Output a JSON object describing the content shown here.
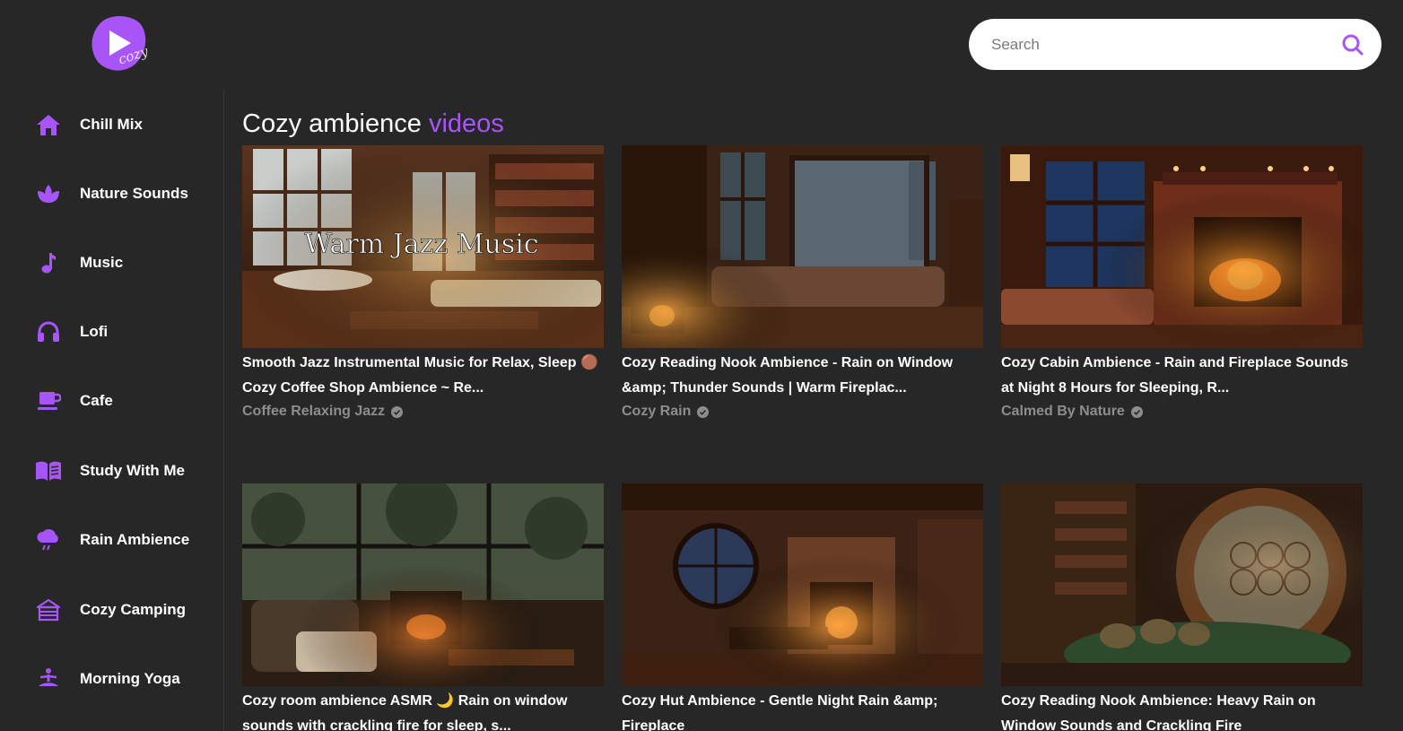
{
  "app": {
    "brand_color": "#a855f7",
    "logo_text": "cozy"
  },
  "search": {
    "placeholder": "Search",
    "value": ""
  },
  "sidebar": {
    "items": [
      {
        "label": "Chill Mix",
        "icon": "home-icon"
      },
      {
        "label": "Nature Sounds",
        "icon": "lotus-icon"
      },
      {
        "label": "Music",
        "icon": "music-note-icon"
      },
      {
        "label": "Lofi",
        "icon": "headphones-icon"
      },
      {
        "label": "Cafe",
        "icon": "coffee-cup-icon"
      },
      {
        "label": "Study With Me",
        "icon": "book-icon"
      },
      {
        "label": "Rain Ambience",
        "icon": "rain-cloud-icon"
      },
      {
        "label": "Cozy Camping",
        "icon": "campsite-icon"
      },
      {
        "label": "Morning Yoga",
        "icon": "yoga-icon"
      }
    ]
  },
  "main": {
    "title_prefix": "Cozy ambience",
    "title_accent": "videos"
  },
  "videos": [
    {
      "title": "Smooth Jazz Instrumental Music for Relax, Sleep 🟤 Cozy Coffee Shop Ambience ~ Re...",
      "channel": "Coffee Relaxing Jazz",
      "thumb_overlay_text": "Warm Jazz Music"
    },
    {
      "title": "Cozy Reading Nook Ambience - Rain on Window &amp; Thunder Sounds | Warm Fireplac...",
      "channel": "Cozy Rain"
    },
    {
      "title": "Cozy Cabin Ambience - Rain and Fireplace Sounds at Night 8 Hours for Sleeping, R...",
      "channel": "Calmed By Nature"
    },
    {
      "title": "Cozy room ambience ASMR 🌙 Rain on window sounds with crackling fire for sleep, s...",
      "channel": ""
    },
    {
      "title": "Cozy Hut Ambience - Gentle Night Rain &amp; Fireplace",
      "channel": ""
    },
    {
      "title": "Cozy Reading Nook Ambience: Heavy Rain on Window Sounds and Crackling Fire",
      "channel": ""
    }
  ]
}
